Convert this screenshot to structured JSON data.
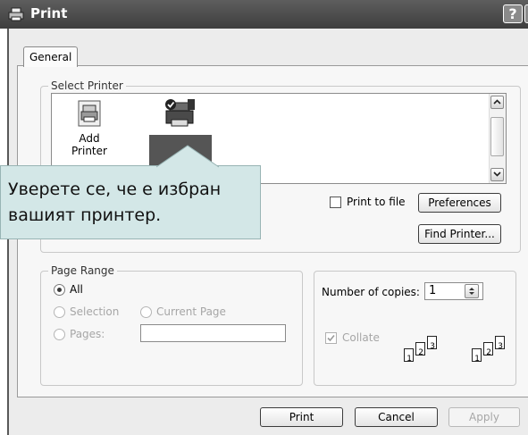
{
  "titlebar": {
    "title": "Print",
    "help_label": "?",
    "close_label": "X"
  },
  "tabs": [
    {
      "label": "General"
    }
  ],
  "select_printer": {
    "legend": "Select Printer",
    "printers": [
      {
        "name": "Add Printer"
      }
    ],
    "print_to_file_label": "Print to file",
    "print_to_file_checked": false,
    "preferences_label": "Preferences",
    "find_printer_label": "Find Printer..."
  },
  "tooltip": {
    "text_line1": "Уверете се, че е избран",
    "text_line2": "вашият принтер."
  },
  "page_range": {
    "legend": "Page Range",
    "all_label": "All",
    "selection_label": "Selection",
    "current_page_label": "Current Page",
    "pages_label": "Pages:",
    "pages_value": "",
    "selected": "All"
  },
  "copies": {
    "number_label": "Number of copies:",
    "value": "1",
    "collate_label": "Collate",
    "collate_checked": true,
    "collate_icon_pages": [
      "1",
      "2",
      "3"
    ]
  },
  "buttons": {
    "print": "Print",
    "cancel": "Cancel",
    "apply": "Apply"
  },
  "colors": {
    "titlebar": "#4e4e4e",
    "tooltip_bg": "#d3e7e7",
    "dialog_bg": "#ececec"
  }
}
